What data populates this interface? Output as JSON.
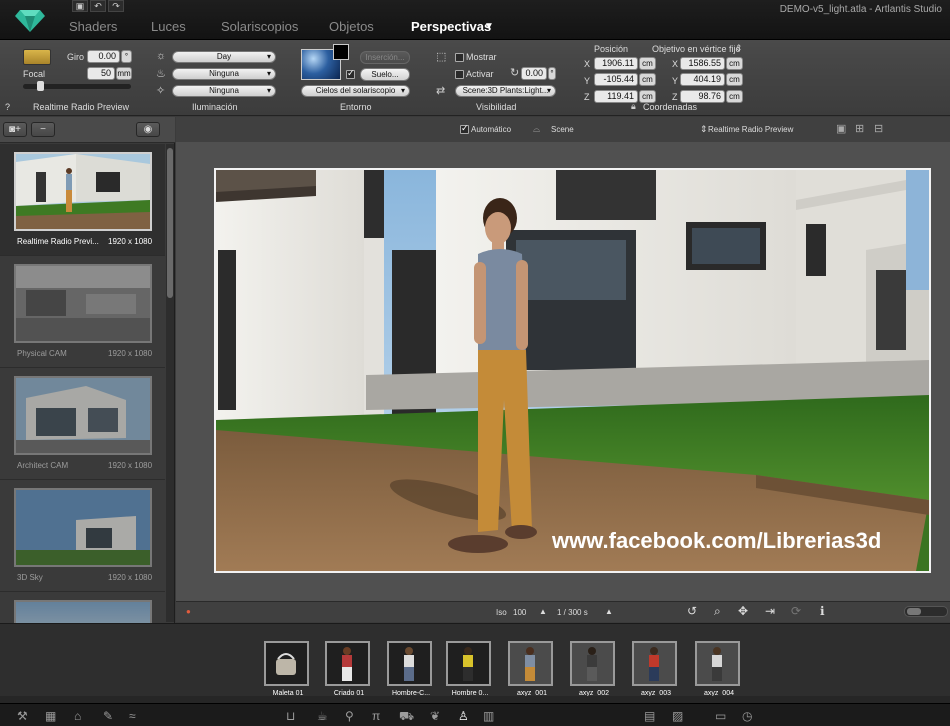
{
  "window": {
    "title": "DEMO-v5_light.atla - Artlantis Studio"
  },
  "quick_access": {
    "save": "▣",
    "undo": "↶",
    "redo": "↷"
  },
  "menu": [
    {
      "label": "Shaders",
      "active": false
    },
    {
      "label": "Luces",
      "active": false
    },
    {
      "label": "Solariscopios",
      "active": false
    },
    {
      "label": "Objetos",
      "active": false
    },
    {
      "label": "Perspectivas",
      "active": true
    }
  ],
  "toolbar": {
    "camera": {
      "giro_label": "Giro",
      "giro_value": "0.00",
      "giro_unit": "°",
      "focal_label": "Focal",
      "focal_value": "50",
      "focal_unit": "mm",
      "section_label": "Realtime Radio Preview",
      "help": "?"
    },
    "lighting": {
      "day_value": "Day",
      "light1_value": "Ninguna",
      "light2_value": "Ninguna",
      "section_label": "Iluminación"
    },
    "environment": {
      "insert_label": "Inserción...",
      "ground_label": "Suelo...",
      "sky_value": "Cielos del solariscopio",
      "section_label": "Entorno"
    },
    "visibility": {
      "show_label": "Mostrar",
      "activate_label": "Activar",
      "angle_value": "0.00",
      "angle_unit": "°",
      "scene_value": "Scene:3D Plants:Light...",
      "section_label": "Visibilidad"
    },
    "coordinates": {
      "position_label": "Posición",
      "target_label": "Objetivo en vértice fijo",
      "x_label": "X",
      "y_label": "Y",
      "z_label": "Z",
      "pos_x": "1906.11",
      "pos_y": "-105.44",
      "pos_z": "119.41",
      "tgt_x": "1586.55",
      "tgt_y": "404.19",
      "tgt_z": "98.76",
      "unit": "cm",
      "section_label": "Coordenadas"
    }
  },
  "left_panel": {
    "add_camera": "+",
    "remove": "−",
    "cameras": [
      {
        "name": "Realtime Radio Previ...",
        "res": "1920 x 1080",
        "selected": true
      },
      {
        "name": "Physical CAM",
        "res": "1920 x 1080",
        "selected": false
      },
      {
        "name": "Architect CAM",
        "res": "1920 x 1080",
        "selected": false
      },
      {
        "name": "3D Sky",
        "res": "1920 x 1080",
        "selected": false
      }
    ]
  },
  "viewport": {
    "auto_label": "Automático",
    "scene_label": "Scene",
    "preview_label": "Realtime Radio Preview",
    "watermark": "www.facebook.com/Librerias3d"
  },
  "status": {
    "iso_label": "Iso",
    "iso_value": "100",
    "shutter_value": "1 / 300 s"
  },
  "library": [
    {
      "name": "Maleta 01"
    },
    {
      "name": "Criado 01"
    },
    {
      "name": "Hombre-C..."
    },
    {
      "name": "Hombre 0..."
    },
    {
      "name": "axyz_001"
    },
    {
      "name": "axyz_002"
    },
    {
      "name": "axyz_003"
    },
    {
      "name": "axyz_004"
    }
  ],
  "colors": {
    "accent": "#2fb89b",
    "panel": "#3a3a3a",
    "topbar": "#1a1a1a",
    "grass": "#3f7a25",
    "deck": "#8a6a48"
  }
}
